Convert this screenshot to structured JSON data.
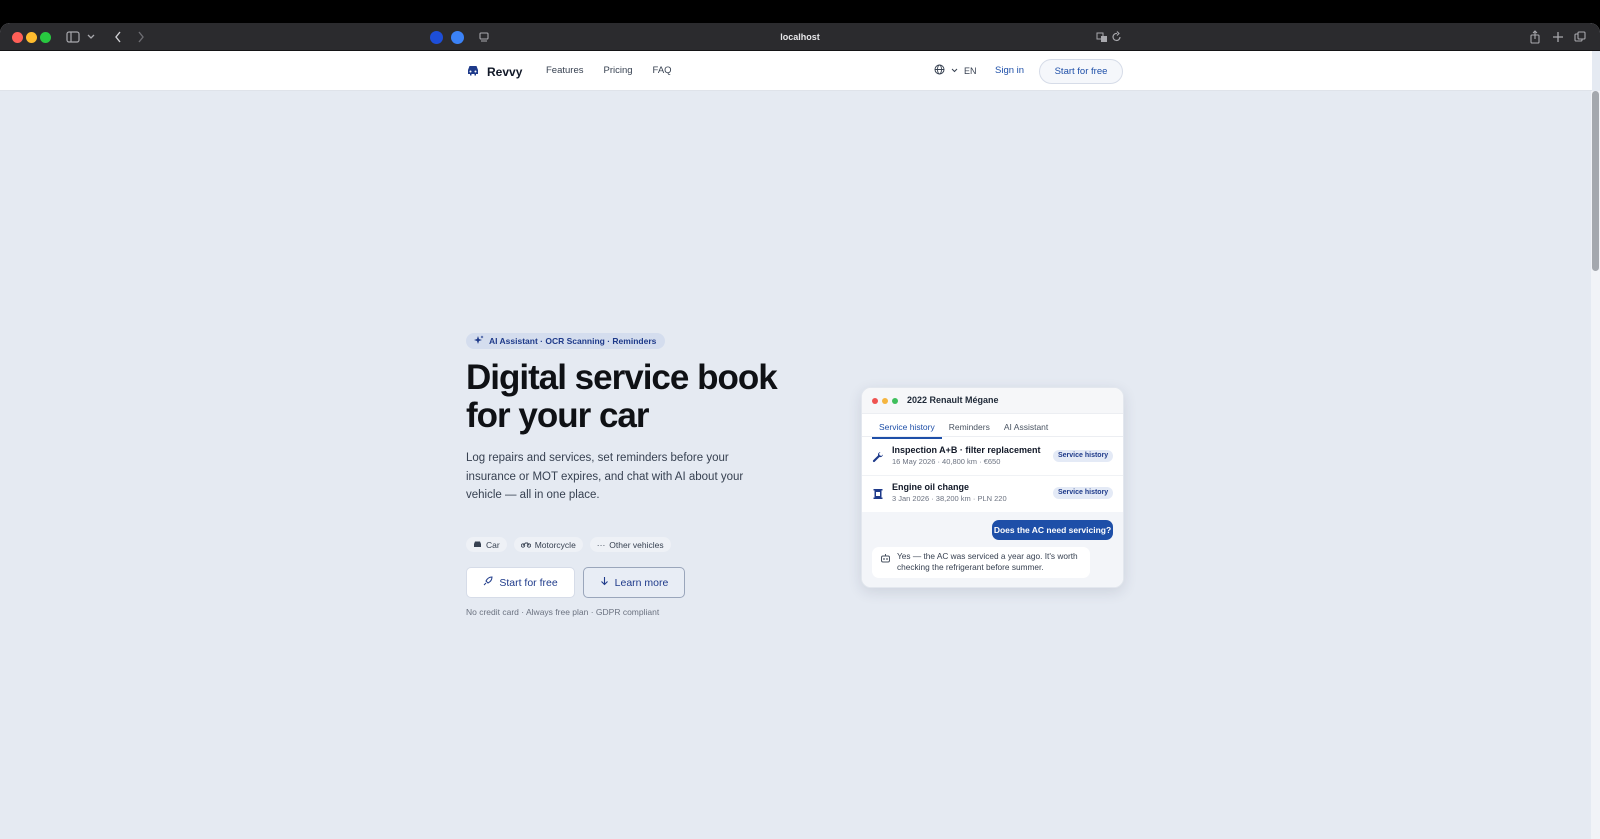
{
  "browser": {
    "url": "localhost"
  },
  "nav": {
    "brand": "Revvy",
    "links": [
      "Features",
      "Pricing",
      "FAQ"
    ],
    "language": "EN",
    "sign_in": "Sign in",
    "cta": "Start for free"
  },
  "hero": {
    "badge": "AI Assistant · OCR Scanning · Reminders",
    "title": "Digital service book for your car",
    "subtitle": "Log repairs and services, set reminders before your insurance or MOT expires, and chat with AI about your vehicle — all in one place.",
    "chips": [
      "Car",
      "Motorcycle",
      "Other vehicles"
    ],
    "primary_button": "Start for free",
    "secondary_button": "Learn more",
    "fineprint": "No credit card · Always free plan · GDPR compliant"
  },
  "mock": {
    "title": "2022 Renault Mégane",
    "tabs": [
      "Service history",
      "Reminders",
      "AI Assistant"
    ],
    "entries": [
      {
        "title": "Inspection A+B · filter replacement",
        "meta": "16 May 2026 · 40,800 km · €650",
        "tag": "Service history",
        "icon": "wrench-icon"
      },
      {
        "title": "Engine oil change",
        "meta": "3 Jan 2026 · 38,200 km · PLN 220",
        "tag": "Service history",
        "icon": "oil-filter-icon"
      }
    ],
    "question": "Does the AC need servicing?",
    "answer": "Yes — the AC was serviced a year ago. It's worth checking the refrigerant before summer."
  },
  "colors": {
    "accent": "#1e4fa8",
    "page_bg": "#e5eaf2",
    "badge_bg": "#d4ddee"
  }
}
